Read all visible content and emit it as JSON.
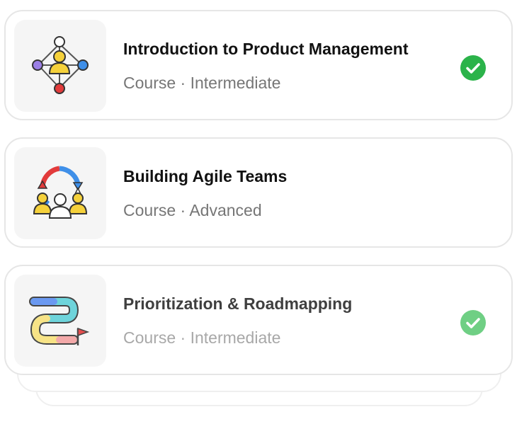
{
  "courses": [
    {
      "title": "Introduction to Product Management",
      "subtitle": "Course · Intermediate",
      "completed": true,
      "icon": "org-network-icon"
    },
    {
      "title": "Building Agile Teams",
      "subtitle": "Course · Advanced",
      "completed": false,
      "icon": "agile-team-icon"
    },
    {
      "title": "Prioritization & Roadmapping",
      "subtitle": "Course · Intermediate",
      "completed": true,
      "icon": "roadmap-path-icon"
    }
  ],
  "colors": {
    "check_green": "#2bb34a",
    "check_green_faded": "#6fcf84"
  }
}
